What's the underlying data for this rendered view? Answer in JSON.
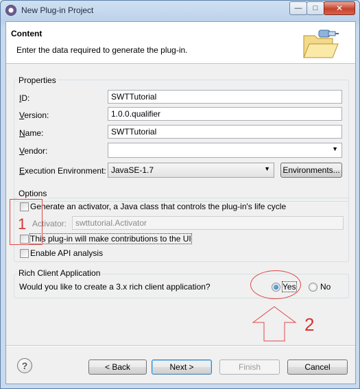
{
  "window": {
    "title": "New Plug-in Project"
  },
  "banner": {
    "title": "Content",
    "description": "Enter the data required to generate the plug-in."
  },
  "properties": {
    "label": "Properties",
    "id_label_u": "I",
    "id_label_rest": "D:",
    "id_value": "SWTTutorial",
    "version_label_u": "V",
    "version_label_rest": "ersion:",
    "version_value": "1.0.0.qualifier",
    "name_label_u": "N",
    "name_label_rest": "ame:",
    "name_value": "SWTTutorial",
    "vendor_label_u": "V",
    "vendor_label_rest": "endor:",
    "vendor_value": "",
    "env_label_u": "E",
    "env_label_rest": "xecution Environment:",
    "env_value": "JavaSE-1.7",
    "env_button": "Environments..."
  },
  "options": {
    "label": "Options",
    "activator_check": "Generate an activator, a Java class that controls the plug-in's life cycle",
    "activator_label": "Activator:",
    "activator_value": "swttutorial.Activator",
    "ui_check": "This plug-in will make contributions to the UI",
    "api_check": "Enable API analysis"
  },
  "rcp": {
    "label": "Rich Client Application",
    "question": "Would you like to create a 3.x rich client application?",
    "yes": "Yes",
    "no": "No"
  },
  "annotations": {
    "one": "1",
    "two": "2"
  },
  "footer": {
    "back": "< Back",
    "next": "Next >",
    "finish": "Finish",
    "cancel": "Cancel",
    "help": "?"
  }
}
